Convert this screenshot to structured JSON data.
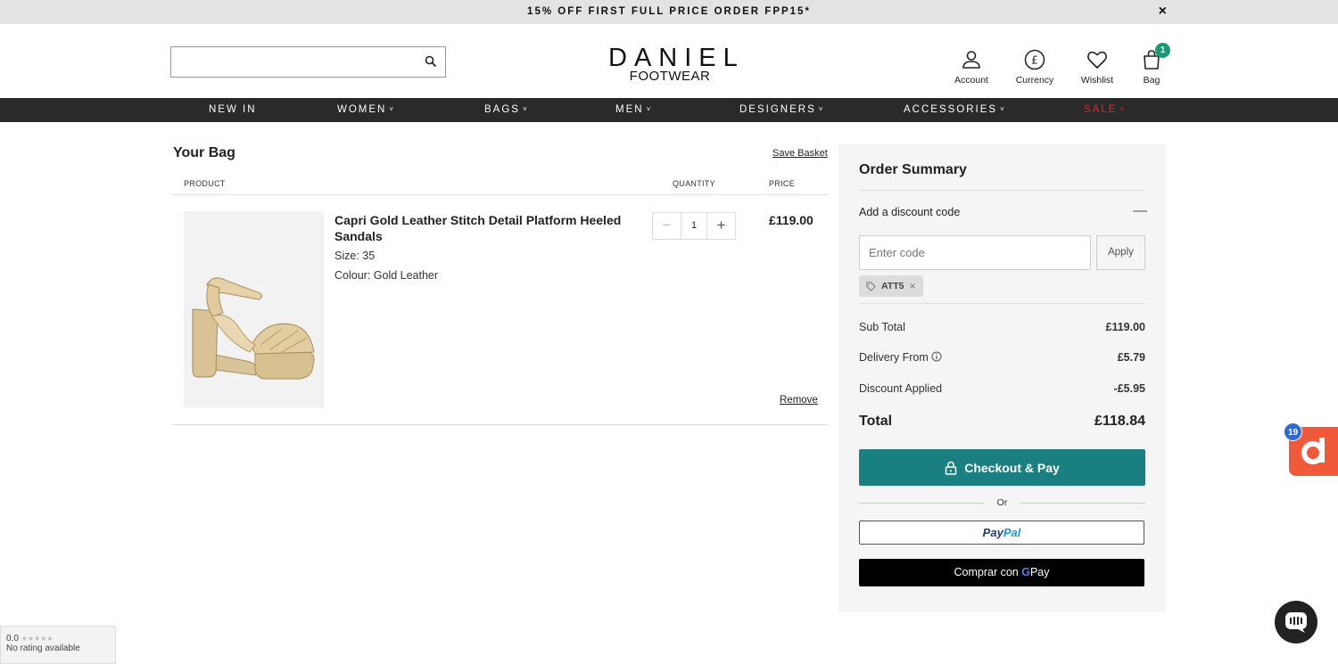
{
  "promo": {
    "text": "15% OFF FIRST FULL PRICE ORDER FPP15*",
    "close_glyph": "×"
  },
  "header": {
    "search": {
      "placeholder": "",
      "value": ""
    },
    "logo": {
      "main": "DANIEL",
      "sub": "FOOTWEAR"
    },
    "icons": {
      "account": "Account",
      "currency": "Currency",
      "wishlist": "Wishlist",
      "bag": "Bag",
      "bag_count": "1"
    }
  },
  "nav": {
    "items": [
      {
        "label": "NEW IN",
        "caret": ""
      },
      {
        "label": "WOMEN",
        "caret": "˅"
      },
      {
        "label": "BAGS",
        "caret": "˅"
      },
      {
        "label": "MEN",
        "caret": "˅"
      },
      {
        "label": "DESIGNERS",
        "caret": "˅"
      },
      {
        "label": "ACCESSORIES",
        "caret": "˅"
      },
      {
        "label": "SALE",
        "caret": "˅"
      }
    ],
    "sale_color": "#e22b2b"
  },
  "bag": {
    "title": "Your Bag",
    "save_basket": "Save Basket",
    "columns": {
      "product": "PRODUCT",
      "quantity": "QUANTITY",
      "price": "PRICE"
    },
    "item": {
      "name": "Capri Gold Leather Stitch Detail Platform Heeled Sandals",
      "size": "Size: 35",
      "colour": "Colour: Gold Leather",
      "quantity": "1",
      "minus": "−",
      "plus": "+",
      "price": "£119.00",
      "remove": "Remove"
    }
  },
  "summary": {
    "title": "Order Summary",
    "discount_label": "Add a discount code",
    "discount_toggle": "—",
    "code_placeholder": "Enter code",
    "apply": "Apply",
    "applied_code": "ATT5",
    "applied_remove": "×",
    "subtotal_label": "Sub Total",
    "subtotal": "£119.00",
    "delivery_label": "Delivery From",
    "delivery": "£5.79",
    "discount_applied_label": "Discount Applied",
    "discount_applied": "-£5.95",
    "total_label": "Total",
    "total": "£118.84",
    "checkout": "Checkout & Pay",
    "or": "Or",
    "paypal_1": "Pay",
    "paypal_2": "Pal",
    "gpay_prefix": "Comprar con",
    "gpay_g": "G",
    "gpay_suffix": "Pay",
    "checkout_color": "#1a7f80"
  },
  "widgets": {
    "rating_score": "0.0",
    "rating_stars": "★★★★★",
    "rating_text": "No rating available",
    "d_badge": "19"
  }
}
